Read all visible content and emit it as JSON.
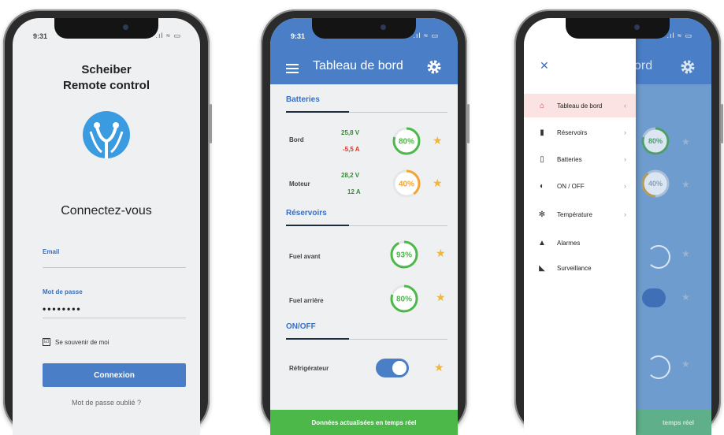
{
  "colors": {
    "primary": "#4a7fc7",
    "green": "#4cb84a",
    "orange": "#f2a534",
    "star": "#f2b632",
    "red": "#d9342b"
  },
  "login": {
    "time": "9:31",
    "status_icons": ".ıl ≈ ▭",
    "title_line1": "Scheiber",
    "title_line2": "Remote control",
    "heading": "Connectez-vous",
    "email_label": "Email",
    "password_label": "Mot de passe",
    "password_value": "••••••••",
    "remember_label": "Se souvenir de moi",
    "remember_check": "☑",
    "login_button": "Connexion",
    "forgot_link": "Mot de passe oublié ?"
  },
  "dashboard": {
    "time": "9:31",
    "status_icons": ".ıl ≈ ▭",
    "title": "Tableau de bord",
    "sections": {
      "batteries": "Batteries",
      "reservoirs": "Réservoirs",
      "onoff": "ON/OFF"
    },
    "batteries": [
      {
        "label": "Bord",
        "voltage": "25,8 V",
        "current": "-5,5 A",
        "percent": "80%",
        "level": 0.8,
        "color": "#4cb84a"
      },
      {
        "label": "Moteur",
        "voltage": "28,2 V",
        "current": "12 A",
        "percent": "40%",
        "level": 0.4,
        "color": "#f2a534"
      }
    ],
    "reservoirs": [
      {
        "label": "Fuel avant",
        "percent": "93%",
        "level": 0.93,
        "color": "#4cb84a"
      },
      {
        "label": "Fuel arrière",
        "percent": "80%",
        "level": 0.8,
        "color": "#4cb84a"
      }
    ],
    "switches": [
      {
        "label": "Réfrigérateur",
        "state": "on"
      }
    ],
    "star": "★",
    "footer": "Données actualisées en temps réel"
  },
  "menu": {
    "status_icons": ".ıl ≈ ▭",
    "close": "✕",
    "background_title": "ord",
    "background_gauge1": "80%",
    "background_gauge2": "40%",
    "background_footer": "temps réel",
    "chevron": "›",
    "active_chevron": "‹",
    "items": [
      {
        "label": "Tableau de bord",
        "icon": "home-icon",
        "glyph": "⌂",
        "active": true
      },
      {
        "label": "Réservoirs",
        "icon": "tank-icon",
        "glyph": "▮",
        "active": false
      },
      {
        "label": "Batteries",
        "icon": "battery-icon",
        "glyph": "▯",
        "active": false
      },
      {
        "label": "ON / OFF",
        "icon": "toggle-icon",
        "glyph": "◐",
        "active": false
      },
      {
        "label": "Température",
        "icon": "snowflake-icon",
        "glyph": "✻",
        "active": false
      },
      {
        "label": "Alarmes",
        "icon": "warning-icon",
        "glyph": "▲",
        "active": false
      },
      {
        "label": "Surveillance",
        "icon": "camera-icon",
        "glyph": "◣",
        "active": false
      }
    ]
  }
}
